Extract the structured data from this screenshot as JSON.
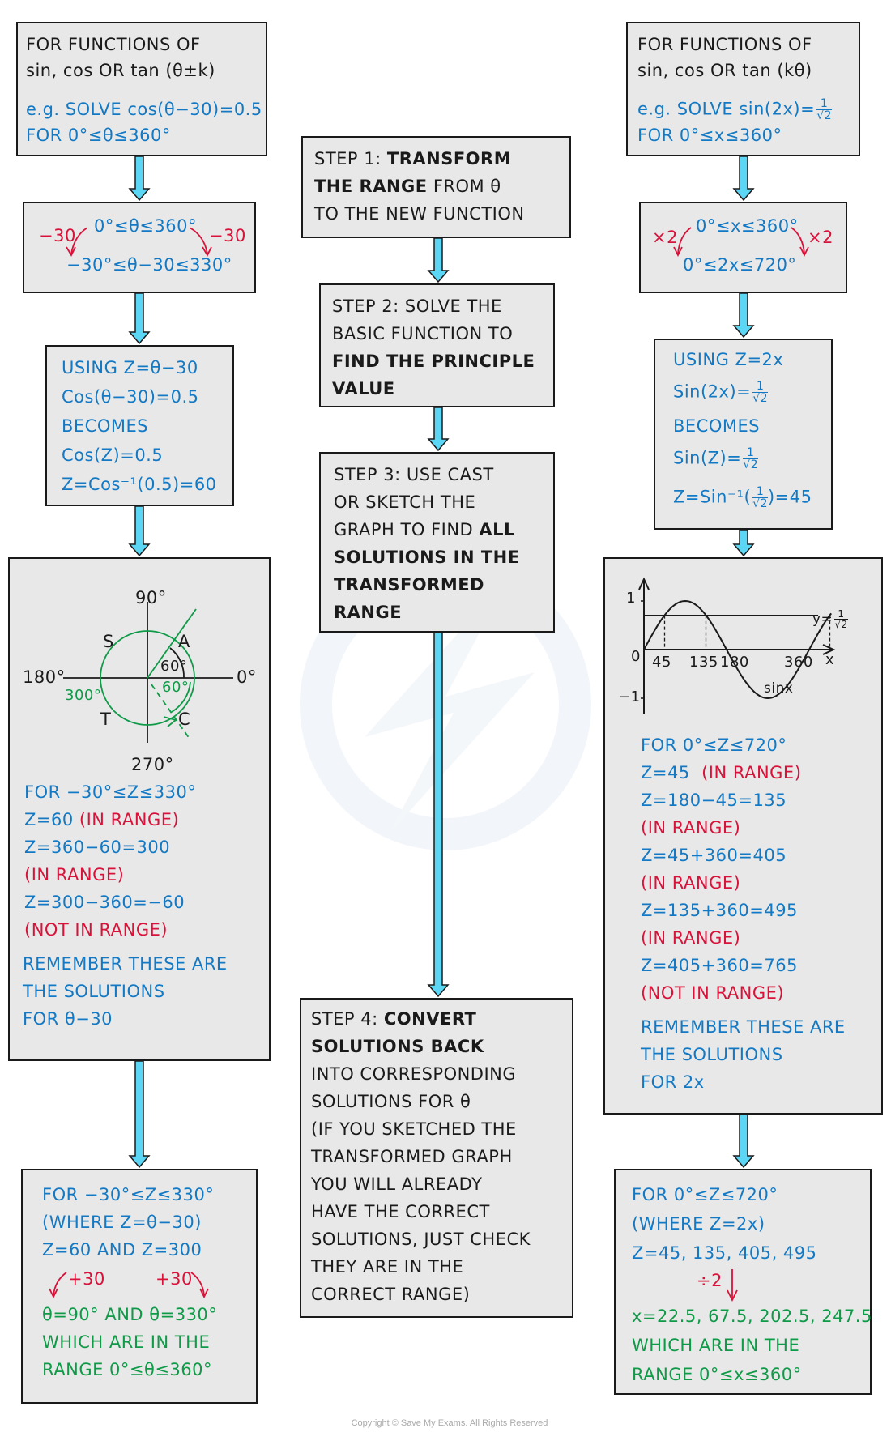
{
  "colors": {
    "box_fill": "#e8e8e8",
    "border": "#1a1a1a",
    "arrow_fill": "#5bd7f5",
    "text_black": "#1a1a1a",
    "text_blue": "#1379c4",
    "text_red": "#d9123a",
    "text_green": "#0f9a48"
  },
  "left": {
    "intro": {
      "line1": "FOR  FUNCTIONS  OF",
      "line2": "sin, cos  OR  tan (θ±k)",
      "example1": "e.g.  SOLVE  cos(θ−30)=0.5",
      "example2": "FOR  0°≤θ≤360°"
    },
    "range": {
      "top": "0°≤θ≤360°",
      "left_op": "−30",
      "right_op": "−30",
      "bottom": "−30°≤θ−30≤330°"
    },
    "substitution": {
      "lines": [
        "USING  Z=θ−30",
        "Cos(θ−30)=0.5",
        "BECOMES",
        "Cos(Z)=0.5",
        "Z=Cos⁻¹(0.5)=60"
      ]
    },
    "cast": {
      "label_90": "90°",
      "label_180": "180°",
      "label_0": "0°",
      "label_270": "270°",
      "quad_s": "S",
      "quad_a": "A",
      "quad_t": "T",
      "quad_c": "C",
      "angle_a": "60°",
      "angle_c": "60°",
      "angle_300": "300°"
    },
    "solutions": {
      "for_range": "FOR  −30°≤Z≤330°",
      "z1": "Z=60",
      "z1_status": "(IN  RANGE)",
      "z2": "Z=360−60=300",
      "z2_status": "(IN  RANGE)",
      "z3": "Z=300−360=−60",
      "z3_status": "(NOT  IN  RANGE)",
      "remember1": "REMEMBER   THESE   ARE",
      "remember2": "THE   SOLUTIONS",
      "remember3": "FOR   θ−30"
    },
    "final": {
      "line1": "FOR   −30°≤Z≤330°",
      "line2": "(WHERE   Z=θ−30)",
      "line3": "Z=60   AND   Z=300",
      "op_left": "+30",
      "op_right": "+30",
      "result": "θ=90°  AND   θ=330°",
      "which": "WHICH   ARE   IN   THE",
      "range": "RANGE   0°≤θ≤360°"
    }
  },
  "middle": {
    "step1": {
      "prefix": "STEP 1:  ",
      "bold1": "TRANSFORM",
      "bold2": "THE  RANGE",
      "rest2": "  FROM  θ",
      "line3": "TO  THE  NEW  FUNCTION"
    },
    "step2": {
      "line1": "STEP 2:  SOLVE   THE",
      "line2": "BASIC  FUNCTION  TO",
      "bold3": "FIND  THE  PRINCIPLE",
      "bold4": "VALUE"
    },
    "step3": {
      "line1": "STEP 3:  USE   CAST",
      "line2": "OR   SKETCH   THE",
      "line3a": "GRAPH   TO   FIND  ",
      "line3b": "ALL",
      "bold4": "SOLUTIONS   IN   THE",
      "bold5": "TRANSFORMED",
      "bold6": "RANGE"
    },
    "step4": {
      "prefix": "STEP 4:  ",
      "bold1": "CONVERT",
      "bold2": "SOLUTIONS   BACK",
      "lines": [
        "INTO   CORRESPONDING",
        "SOLUTIONS   FOR   θ",
        "(IF  YOU  SKETCHED  THE",
        "TRANSFORMED   GRAPH",
        "YOU   WILL   ALREADY",
        "HAVE   THE   CORRECT",
        "SOLUTIONS,  JUST  CHECK",
        "THEY   ARE   IN   THE",
        "CORRECT   RANGE)"
      ]
    }
  },
  "right": {
    "intro": {
      "line1": "FOR   FUNCTIONS   OF",
      "line2": "sin, cos   OR   tan (kθ)",
      "example1": "e.g.   SOLVE   sin(2x)=",
      "frac_num": "1",
      "frac_den": "√2",
      "example2": "FOR   0°≤x≤360°"
    },
    "range": {
      "top": "0°≤x≤360°",
      "left_op": "×2",
      "right_op": "×2",
      "bottom": "0°≤2x≤720°"
    },
    "substitution": {
      "line1": "USING   Z=2x",
      "line2": "Sin(2x)=",
      "line3": "BECOMES",
      "line4": "Sin(Z)=",
      "line5a": "Z=Sin⁻¹(",
      "line5b": ")=45",
      "frac_num": "1",
      "frac_den": "√2"
    },
    "graph": {
      "y_tick_pos": "1",
      "y_tick_neg": "−1",
      "origin": "0",
      "x_axis_label": "x",
      "x_ticks": [
        "45",
        "135",
        "180",
        "360"
      ],
      "curve_label": "sinx",
      "line_label": "y=",
      "line_frac_num": "1",
      "line_frac_den": "√2"
    },
    "solutions": {
      "for_range": "FOR    0°≤Z≤720°",
      "z1": "Z=45",
      "z1_status": "(IN   RANGE)",
      "z2": "Z=180−45=135",
      "z2_status": "(IN   RANGE)",
      "z3": "Z=45+360=405",
      "z3_status": "(IN   RANGE)",
      "z4": "Z=135+360=495",
      "z4_status": "(IN   RANGE)",
      "z5": "Z=405+360=765",
      "z5_status": "(NOT   IN   RANGE)",
      "remember1": "REMEMBER   THESE   ARE",
      "remember2": "THE   SOLUTIONS",
      "remember3": "FOR   2x"
    },
    "final": {
      "line1": "FOR    0°≤Z≤720°",
      "line2": "(WHERE    Z=2x)",
      "line3": "Z=45, 135, 405, 495",
      "op": "÷2",
      "result": "x=22.5, 67.5, 202.5, 247.5",
      "which": "WHICH   ARE   IN   THE",
      "range": "RANGE   0°≤x≤360°"
    }
  },
  "footer": {
    "copyright": "Copyright © Save My Exams. All Rights Reserved"
  }
}
